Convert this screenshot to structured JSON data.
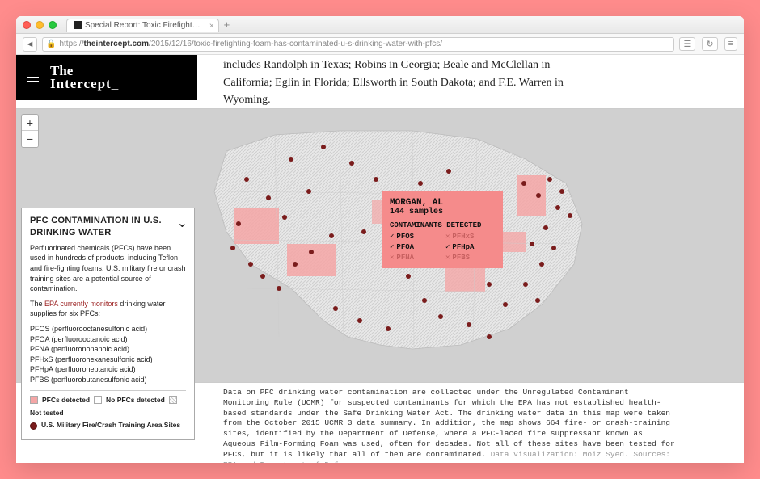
{
  "browser": {
    "tab_title": "Special Report: Toxic Firefight…",
    "url_prefix": "https://",
    "url_domain": "theintercept.com",
    "url_path": "/2015/12/16/toxic-firefighting-foam-has-contaminated-u-s-drinking-water-with-pfcs/"
  },
  "header": {
    "logo_line1": "The",
    "logo_line2": "Intercept_"
  },
  "article": {
    "snippet": "includes Randolph in Texas; Robins in Georgia; Beale and McClellan in California; Eglin in Florida; Ellsworth in South Dakota; and F.E. Warren in Wyoming."
  },
  "zoom": {
    "in": "+",
    "out": "−"
  },
  "sidebar": {
    "title": "PFC CONTAMINATION IN U.S. DRINKING WATER",
    "intro": "Perfluorinated chemicals (PFCs) have been used in hundreds of products, including Teflon and fire-fighting foams. U.S. military fire or crash training sites are a potential source of contamination.",
    "monitor_prelink": "The ",
    "monitor_link": "EPA currently monitors",
    "monitor_post": " drinking water supplies for six PFCs:",
    "pfcs": [
      "PFOS (perfluorooctanesulfonic acid)",
      "PFOA (perfluorooctanoic acid)",
      "PFNA (perfluorononanoic acid)",
      "PFHxS (perfluorohexanesulfonic acid)",
      "PFHpA (perfluoroheptanoic acid)",
      "PFBS (perfluorobutanesulfonic acid)"
    ],
    "legend": {
      "detected": "PFCs detected",
      "none": "No PFCs detected",
      "nottested": "Not tested",
      "military": "U.S. Military Fire/Crash Training Area Sites"
    }
  },
  "tooltip": {
    "location": "MORGAN, AL",
    "samples": "144 samples",
    "label": "CONTAMINANTS DETECTED",
    "items": [
      {
        "name": "PFOS",
        "detected": true
      },
      {
        "name": "PFHxS",
        "detected": false
      },
      {
        "name": "PFOA",
        "detected": true
      },
      {
        "name": "PFHpA",
        "detected": true
      },
      {
        "name": "PFNA",
        "detected": false
      },
      {
        "name": "PFBS",
        "detected": false
      }
    ]
  },
  "caption": {
    "body": "Data on PFC drinking water contamination are collected under the Unregulated Contaminant Monitoring Rule (UCMR) for suspected contaminants for which the EPA has not established health-based standards under the Safe Drinking Water Act. The drinking water data in this map were taken from the October 2015 UCMR 3 data summary. In addition, the map shows 664 fire- or crash-training sites, identified by the Department of Defense, where a PFC-laced fire suppressant known as Aqueous Film-Forming Foam was used, often for decades. Not all of these sites have been tested for PFCs, but it is likely that all of them are contaminated. ",
    "credit": "Data visualization: Moiz Syed. Sources: EPA and Department of Defense."
  }
}
